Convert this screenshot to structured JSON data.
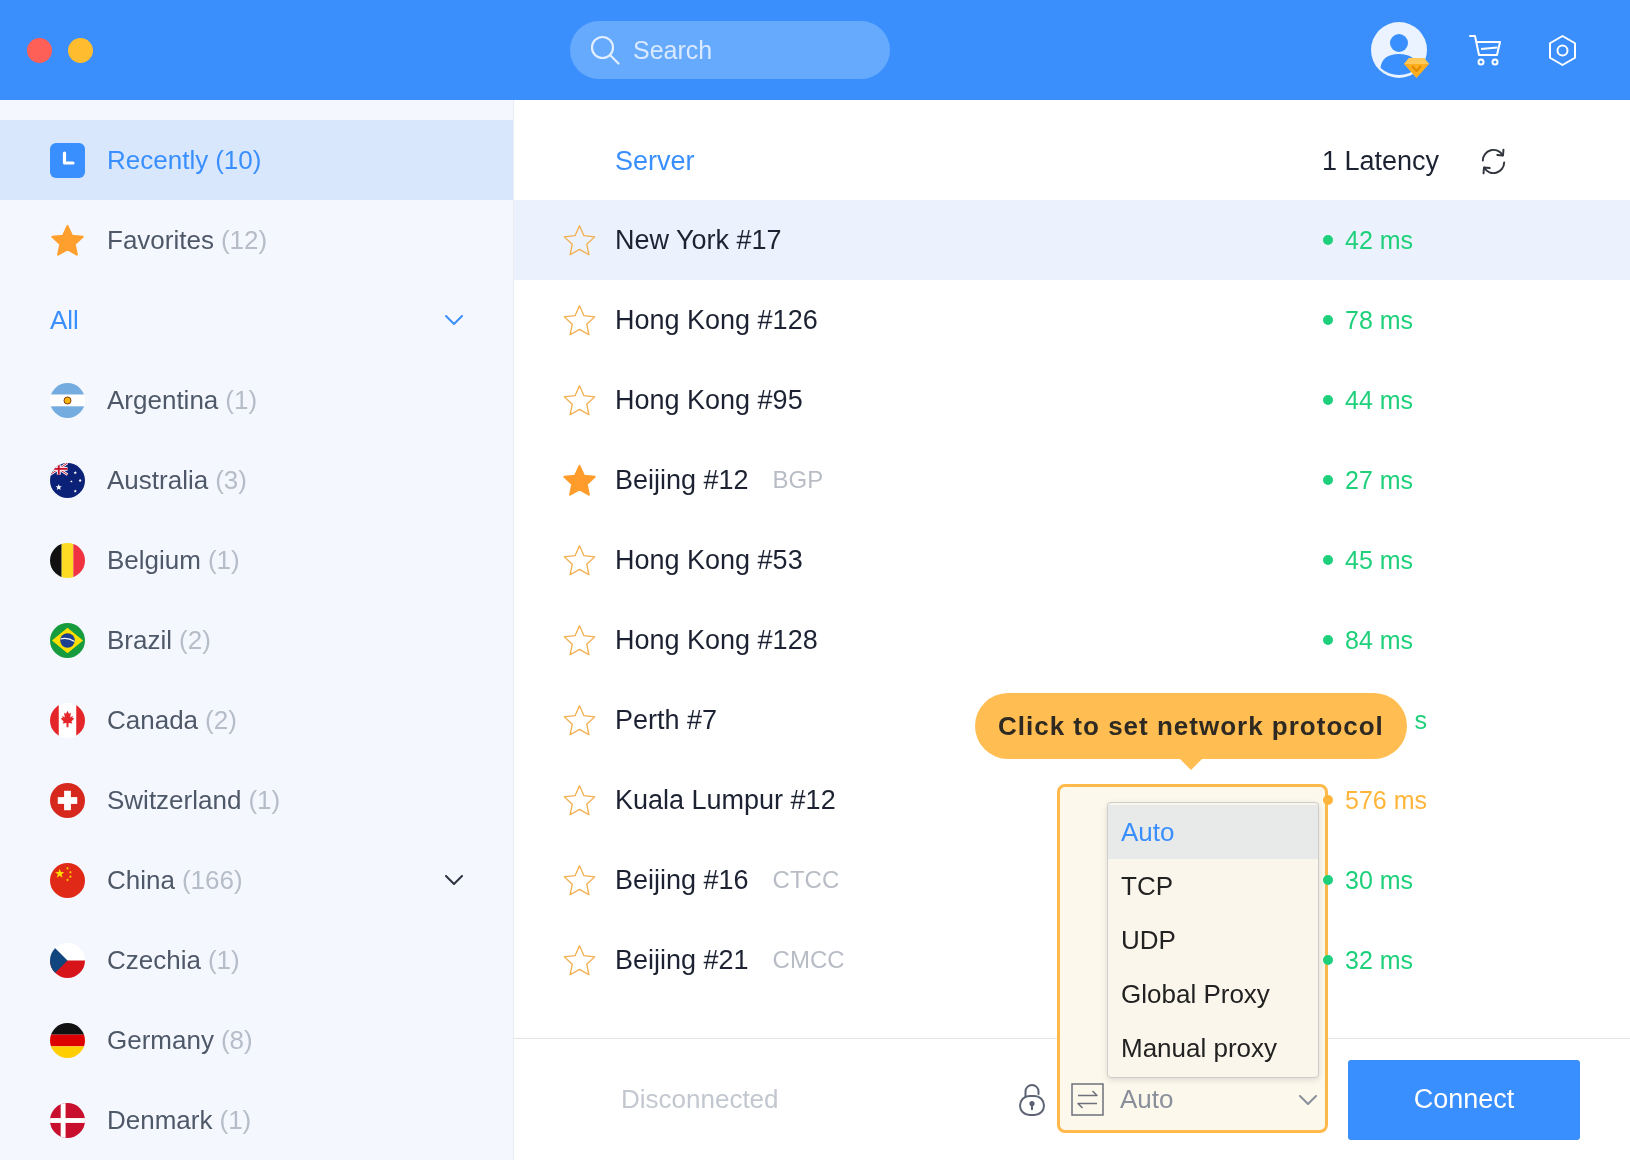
{
  "search": {
    "placeholder": "Search"
  },
  "sidebar": {
    "items": [
      {
        "kind": "recent",
        "label": "Recently",
        "count": "(10)",
        "selected": true
      },
      {
        "kind": "favorites",
        "label": "Favorites",
        "count": "(12)",
        "selected": false
      }
    ],
    "filter": {
      "label": "All"
    },
    "countries": [
      {
        "kind": "argentina",
        "name": "Argentina",
        "count": "(1)",
        "selected": false,
        "expandable": false
      },
      {
        "kind": "australia",
        "name": "Australia",
        "count": "(3)",
        "selected": false,
        "expandable": false
      },
      {
        "kind": "belgium",
        "name": "Belgium",
        "count": "(1)",
        "selected": false,
        "expandable": false
      },
      {
        "kind": "brazil",
        "name": "Brazil",
        "count": "(2)",
        "selected": false,
        "expandable": false
      },
      {
        "kind": "canada",
        "name": "Canada",
        "count": "(2)",
        "selected": false,
        "expandable": false
      },
      {
        "kind": "switzerland",
        "name": "Switzerland",
        "count": "(1)",
        "selected": false,
        "expandable": false
      },
      {
        "kind": "china",
        "name": "China",
        "count": "(166)",
        "selected": false,
        "expandable": true
      },
      {
        "kind": "czechia",
        "name": "Czechia",
        "count": "(1)",
        "selected": false,
        "expandable": false
      },
      {
        "kind": "germany",
        "name": "Germany",
        "count": "(8)",
        "selected": false,
        "expandable": false
      },
      {
        "kind": "denmark",
        "name": "Denmark",
        "count": "(1)",
        "selected": false,
        "expandable": false
      }
    ]
  },
  "server_list": {
    "columns": [
      "Server",
      "1 Latency"
    ],
    "servers": [
      {
        "name": "New York #17",
        "favorite": false,
        "selected": true,
        "latency": "42 ms",
        "color": "#1fd07b",
        "dot": true
      },
      {
        "name": "Hong Kong #126",
        "favorite": false,
        "selected": false,
        "latency": "78 ms",
        "color": "#1fd07b",
        "dot": true
      },
      {
        "name": "Hong Kong #95",
        "favorite": false,
        "selected": false,
        "latency": "44 ms",
        "color": "#1fd07b",
        "dot": true
      },
      {
        "name": "Beijing #12",
        "tag": "BGP",
        "favorite": true,
        "selected": false,
        "latency": "27 ms",
        "color": "#1fd07b",
        "dot": true
      },
      {
        "name": "Hong Kong #53",
        "favorite": false,
        "selected": false,
        "latency": "45 ms",
        "color": "#1fd07b",
        "dot": true
      },
      {
        "name": "Hong Kong #128",
        "favorite": false,
        "selected": false,
        "latency": "84 ms",
        "color": "#1fd07b",
        "dot": true
      },
      {
        "name": "Perth #7",
        "favorite": false,
        "selected": false,
        "latency": "s",
        "color": "#1fd07b",
        "dot": false
      },
      {
        "name": "Kuala Lumpur #12",
        "favorite": false,
        "selected": false,
        "latency": "576 ms",
        "color": "#ffb53a",
        "dot": true
      },
      {
        "name": "Beijing #16",
        "tag": "CTCC",
        "favorite": false,
        "selected": false,
        "latency": "30 ms",
        "color": "#1fd07b",
        "dot": true
      },
      {
        "name": "Beijing #21",
        "tag": "CMCC",
        "favorite": false,
        "selected": false,
        "latency": "32 ms",
        "color": "#1fd07b",
        "dot": true
      }
    ]
  },
  "tooltip": {
    "text": "Click to set network protocol"
  },
  "protocol_menu": {
    "options": [
      {
        "label": "Auto",
        "selected": true
      },
      {
        "label": "TCP",
        "selected": false
      },
      {
        "label": "UDP",
        "selected": false
      },
      {
        "label": "Global Proxy",
        "selected": false
      },
      {
        "label": "Manual proxy",
        "selected": false
      }
    ]
  },
  "footer": {
    "status": "Disconnected",
    "protocol": "Auto",
    "connect_button": "Connect"
  }
}
